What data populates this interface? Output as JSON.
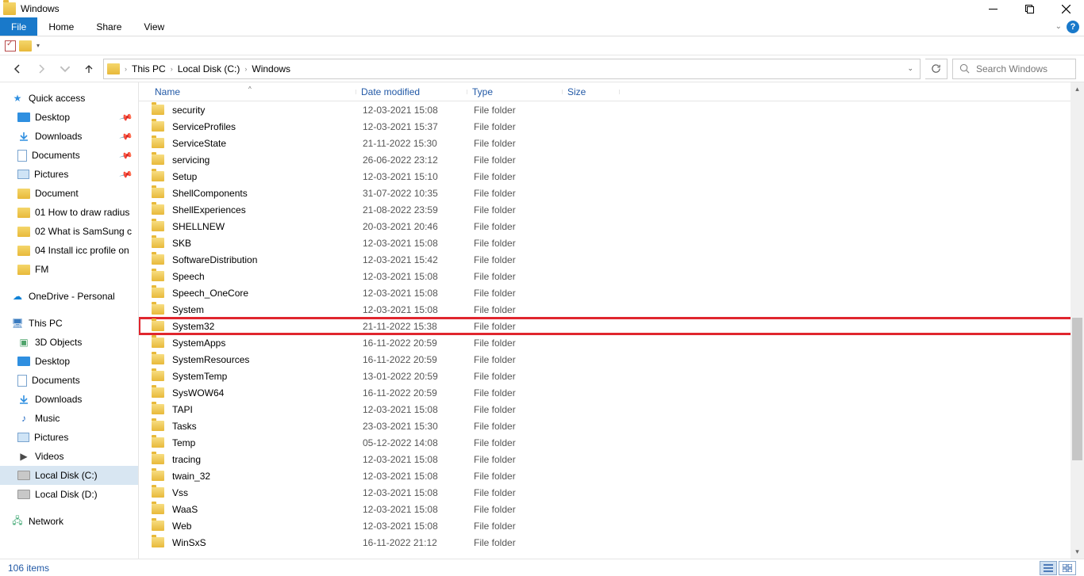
{
  "window": {
    "title": "Windows"
  },
  "ribbon": {
    "file": "File",
    "home": "Home",
    "share": "Share",
    "view": "View"
  },
  "breadcrumbs": {
    "pc": "This PC",
    "disk": "Local Disk (C:)",
    "win": "Windows"
  },
  "search": {
    "placeholder": "Search Windows"
  },
  "sidebar": {
    "quick": "Quick access",
    "desktop": "Desktop",
    "downloads": "Downloads",
    "documents": "Documents",
    "pictures": "Pictures",
    "document": "Document",
    "f1": "01 How to draw radius",
    "f2": "02 What is SamSung c",
    "f3": "04 Install icc profile on",
    "f4": "FM",
    "onedrive": "OneDrive - Personal",
    "thispc": "This PC",
    "obj3d": "3D Objects",
    "desktop2": "Desktop",
    "documents2": "Documents",
    "downloads2": "Downloads",
    "music": "Music",
    "pictures2": "Pictures",
    "videos": "Videos",
    "diskc": "Local Disk (C:)",
    "diskd": "Local Disk (D:)",
    "network": "Network"
  },
  "columns": {
    "name": "Name",
    "date": "Date modified",
    "type": "Type",
    "size": "Size"
  },
  "rows": [
    {
      "name": "security",
      "date": "12-03-2021 15:08",
      "type": "File folder"
    },
    {
      "name": "ServiceProfiles",
      "date": "12-03-2021 15:37",
      "type": "File folder"
    },
    {
      "name": "ServiceState",
      "date": "21-11-2022 15:30",
      "type": "File folder"
    },
    {
      "name": "servicing",
      "date": "26-06-2022 23:12",
      "type": "File folder"
    },
    {
      "name": "Setup",
      "date": "12-03-2021 15:10",
      "type": "File folder"
    },
    {
      "name": "ShellComponents",
      "date": "31-07-2022 10:35",
      "type": "File folder"
    },
    {
      "name": "ShellExperiences",
      "date": "21-08-2022 23:59",
      "type": "File folder"
    },
    {
      "name": "SHELLNEW",
      "date": "20-03-2021 20:46",
      "type": "File folder"
    },
    {
      "name": "SKB",
      "date": "12-03-2021 15:08",
      "type": "File folder"
    },
    {
      "name": "SoftwareDistribution",
      "date": "12-03-2021 15:42",
      "type": "File folder"
    },
    {
      "name": "Speech",
      "date": "12-03-2021 15:08",
      "type": "File folder"
    },
    {
      "name": "Speech_OneCore",
      "date": "12-03-2021 15:08",
      "type": "File folder"
    },
    {
      "name": "System",
      "date": "12-03-2021 15:08",
      "type": "File folder"
    },
    {
      "name": "System32",
      "date": "21-11-2022 15:38",
      "type": "File folder",
      "highlight": true
    },
    {
      "name": "SystemApps",
      "date": "16-11-2022 20:59",
      "type": "File folder"
    },
    {
      "name": "SystemResources",
      "date": "16-11-2022 20:59",
      "type": "File folder"
    },
    {
      "name": "SystemTemp",
      "date": "13-01-2022 20:59",
      "type": "File folder"
    },
    {
      "name": "SysWOW64",
      "date": "16-11-2022 20:59",
      "type": "File folder"
    },
    {
      "name": "TAPI",
      "date": "12-03-2021 15:08",
      "type": "File folder"
    },
    {
      "name": "Tasks",
      "date": "23-03-2021 15:30",
      "type": "File folder"
    },
    {
      "name": "Temp",
      "date": "05-12-2022 14:08",
      "type": "File folder"
    },
    {
      "name": "tracing",
      "date": "12-03-2021 15:08",
      "type": "File folder"
    },
    {
      "name": "twain_32",
      "date": "12-03-2021 15:08",
      "type": "File folder"
    },
    {
      "name": "Vss",
      "date": "12-03-2021 15:08",
      "type": "File folder"
    },
    {
      "name": "WaaS",
      "date": "12-03-2021 15:08",
      "type": "File folder"
    },
    {
      "name": "Web",
      "date": "12-03-2021 15:08",
      "type": "File folder"
    },
    {
      "name": "WinSxS",
      "date": "16-11-2022 21:12",
      "type": "File folder"
    }
  ],
  "status": {
    "count": "106 items"
  }
}
